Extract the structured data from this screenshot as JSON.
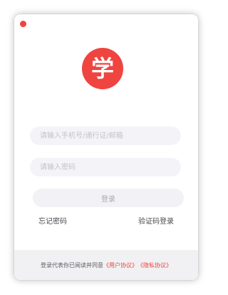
{
  "window": {
    "close_color": "#f0423f"
  },
  "logo": {
    "char": "学",
    "color": "#f04440"
  },
  "form": {
    "phone_placeholder": "请输入手机号/通行证/邮箱",
    "phone_value": "",
    "password_placeholder": "请输入密码",
    "password_value": "",
    "login_label": "登录"
  },
  "links": {
    "forgot_password": "忘记密码",
    "code_login": "验证码登录"
  },
  "footer": {
    "agreement_prefix": "登录代表你已阅读并同意",
    "user_agreement": "《用户协议》",
    "privacy_policy": "《隐私协议》",
    "link_color": "#f0423f"
  }
}
